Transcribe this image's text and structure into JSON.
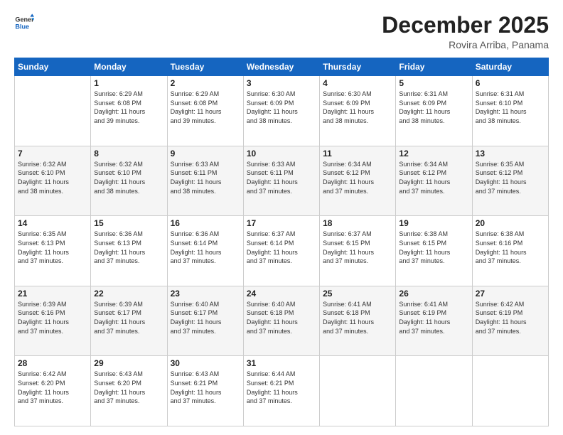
{
  "logo": {
    "general": "General",
    "blue": "Blue"
  },
  "title": "December 2025",
  "subtitle": "Rovira Arriba, Panama",
  "days_of_week": [
    "Sunday",
    "Monday",
    "Tuesday",
    "Wednesday",
    "Thursday",
    "Friday",
    "Saturday"
  ],
  "weeks": [
    [
      {
        "day": "",
        "info": ""
      },
      {
        "day": "1",
        "info": "Sunrise: 6:29 AM\nSunset: 6:08 PM\nDaylight: 11 hours\nand 39 minutes."
      },
      {
        "day": "2",
        "info": "Sunrise: 6:29 AM\nSunset: 6:08 PM\nDaylight: 11 hours\nand 39 minutes."
      },
      {
        "day": "3",
        "info": "Sunrise: 6:30 AM\nSunset: 6:09 PM\nDaylight: 11 hours\nand 38 minutes."
      },
      {
        "day": "4",
        "info": "Sunrise: 6:30 AM\nSunset: 6:09 PM\nDaylight: 11 hours\nand 38 minutes."
      },
      {
        "day": "5",
        "info": "Sunrise: 6:31 AM\nSunset: 6:09 PM\nDaylight: 11 hours\nand 38 minutes."
      },
      {
        "day": "6",
        "info": "Sunrise: 6:31 AM\nSunset: 6:10 PM\nDaylight: 11 hours\nand 38 minutes."
      }
    ],
    [
      {
        "day": "7",
        "info": "Sunrise: 6:32 AM\nSunset: 6:10 PM\nDaylight: 11 hours\nand 38 minutes."
      },
      {
        "day": "8",
        "info": "Sunrise: 6:32 AM\nSunset: 6:10 PM\nDaylight: 11 hours\nand 38 minutes."
      },
      {
        "day": "9",
        "info": "Sunrise: 6:33 AM\nSunset: 6:11 PM\nDaylight: 11 hours\nand 38 minutes."
      },
      {
        "day": "10",
        "info": "Sunrise: 6:33 AM\nSunset: 6:11 PM\nDaylight: 11 hours\nand 37 minutes."
      },
      {
        "day": "11",
        "info": "Sunrise: 6:34 AM\nSunset: 6:12 PM\nDaylight: 11 hours\nand 37 minutes."
      },
      {
        "day": "12",
        "info": "Sunrise: 6:34 AM\nSunset: 6:12 PM\nDaylight: 11 hours\nand 37 minutes."
      },
      {
        "day": "13",
        "info": "Sunrise: 6:35 AM\nSunset: 6:12 PM\nDaylight: 11 hours\nand 37 minutes."
      }
    ],
    [
      {
        "day": "14",
        "info": "Sunrise: 6:35 AM\nSunset: 6:13 PM\nDaylight: 11 hours\nand 37 minutes."
      },
      {
        "day": "15",
        "info": "Sunrise: 6:36 AM\nSunset: 6:13 PM\nDaylight: 11 hours\nand 37 minutes."
      },
      {
        "day": "16",
        "info": "Sunrise: 6:36 AM\nSunset: 6:14 PM\nDaylight: 11 hours\nand 37 minutes."
      },
      {
        "day": "17",
        "info": "Sunrise: 6:37 AM\nSunset: 6:14 PM\nDaylight: 11 hours\nand 37 minutes."
      },
      {
        "day": "18",
        "info": "Sunrise: 6:37 AM\nSunset: 6:15 PM\nDaylight: 11 hours\nand 37 minutes."
      },
      {
        "day": "19",
        "info": "Sunrise: 6:38 AM\nSunset: 6:15 PM\nDaylight: 11 hours\nand 37 minutes."
      },
      {
        "day": "20",
        "info": "Sunrise: 6:38 AM\nSunset: 6:16 PM\nDaylight: 11 hours\nand 37 minutes."
      }
    ],
    [
      {
        "day": "21",
        "info": "Sunrise: 6:39 AM\nSunset: 6:16 PM\nDaylight: 11 hours\nand 37 minutes."
      },
      {
        "day": "22",
        "info": "Sunrise: 6:39 AM\nSunset: 6:17 PM\nDaylight: 11 hours\nand 37 minutes."
      },
      {
        "day": "23",
        "info": "Sunrise: 6:40 AM\nSunset: 6:17 PM\nDaylight: 11 hours\nand 37 minutes."
      },
      {
        "day": "24",
        "info": "Sunrise: 6:40 AM\nSunset: 6:18 PM\nDaylight: 11 hours\nand 37 minutes."
      },
      {
        "day": "25",
        "info": "Sunrise: 6:41 AM\nSunset: 6:18 PM\nDaylight: 11 hours\nand 37 minutes."
      },
      {
        "day": "26",
        "info": "Sunrise: 6:41 AM\nSunset: 6:19 PM\nDaylight: 11 hours\nand 37 minutes."
      },
      {
        "day": "27",
        "info": "Sunrise: 6:42 AM\nSunset: 6:19 PM\nDaylight: 11 hours\nand 37 minutes."
      }
    ],
    [
      {
        "day": "28",
        "info": "Sunrise: 6:42 AM\nSunset: 6:20 PM\nDaylight: 11 hours\nand 37 minutes."
      },
      {
        "day": "29",
        "info": "Sunrise: 6:43 AM\nSunset: 6:20 PM\nDaylight: 11 hours\nand 37 minutes."
      },
      {
        "day": "30",
        "info": "Sunrise: 6:43 AM\nSunset: 6:21 PM\nDaylight: 11 hours\nand 37 minutes."
      },
      {
        "day": "31",
        "info": "Sunrise: 6:44 AM\nSunset: 6:21 PM\nDaylight: 11 hours\nand 37 minutes."
      },
      {
        "day": "",
        "info": ""
      },
      {
        "day": "",
        "info": ""
      },
      {
        "day": "",
        "info": ""
      }
    ]
  ]
}
